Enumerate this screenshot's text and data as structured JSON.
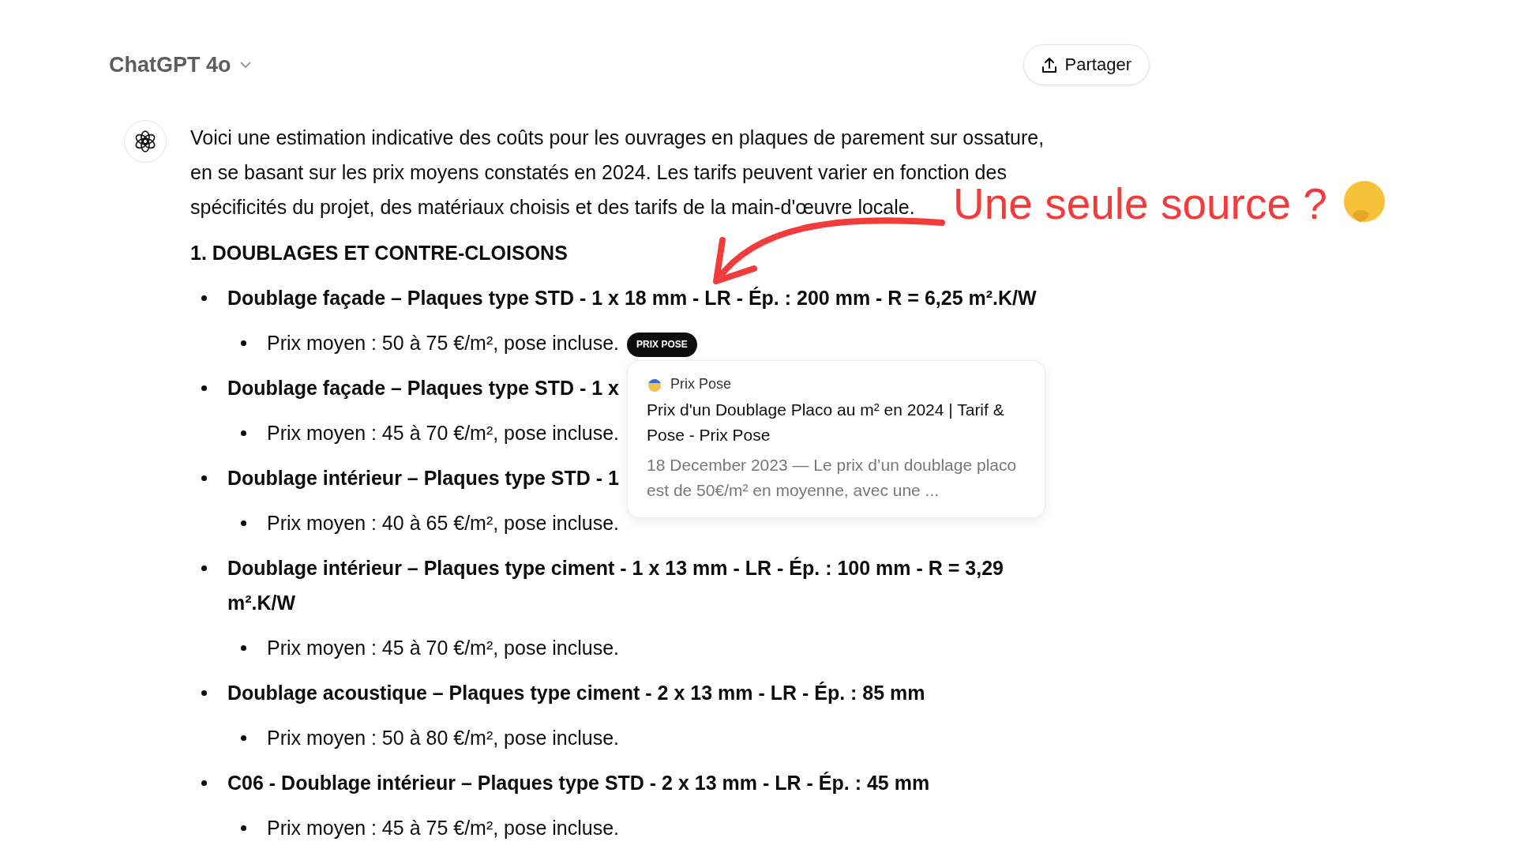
{
  "header": {
    "model": "ChatGPT 4o",
    "share": "Partager"
  },
  "message": {
    "intro_lines": [
      "Voici une estimation indicative des coûts pour les ouvrages en plaques de parement sur ossature,",
      "en se basant sur les prix moyens constatés en 2024. Les tarifs peuvent varier en fonction des",
      "spécificités du projet, des matériaux choisis et des tarifs de la main-d'œuvre locale."
    ],
    "heading": "1. DOUBLAGES ET CONTRE-CLOISONS",
    "items": [
      {
        "title": "Doublage façade – Plaques type STD - 1 x 18 mm - LR - Ép. : 200 mm - R = 6,25 m².K/W",
        "sub": [
          {
            "text": "Prix moyen : 50 à 75 €/m², pose incluse.",
            "badge": "PRIX POSE"
          }
        ]
      },
      {
        "title": "Doublage façade – Plaques type STD - 1 x",
        "sub": [
          {
            "text": "Prix moyen : 45 à 70 €/m², pose incluse."
          }
        ]
      },
      {
        "title": "Doublage intérieur – Plaques type STD - 1",
        "sub": [
          {
            "text": "Prix moyen : 40 à 65 €/m², pose incluse."
          }
        ]
      },
      {
        "title": "Doublage intérieur – Plaques type ciment - 1 x 13 mm - LR - Ép. : 100 mm - R = 3,29 m².K/W",
        "sub": [
          {
            "text": "Prix moyen : 45 à 70 €/m², pose incluse."
          }
        ]
      },
      {
        "title": "Doublage acoustique – Plaques type ciment - 2 x 13 mm - LR - Ép. : 85 mm",
        "sub": [
          {
            "text": "Prix moyen : 50 à 80 €/m², pose incluse."
          }
        ]
      },
      {
        "title": "C06 - Doublage intérieur – Plaques type STD - 2 x 13 mm - LR - Ép. : 45 mm",
        "sub": [
          {
            "text": "Prix moyen : 45 à 75 €/m², pose incluse."
          }
        ]
      }
    ]
  },
  "tooltip": {
    "source": "Prix Pose",
    "title": "Prix d'un Doublage Placo au m² en 2024 | Tarif & Pose - Prix Pose",
    "snippet": "18 December 2023 — Le prix d’un doublage placo est de 50€/m² en moyenne, avec une ..."
  },
  "annotation": {
    "text": "Une seule source ?"
  }
}
